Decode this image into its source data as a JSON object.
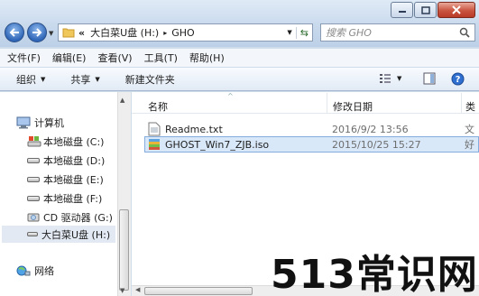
{
  "address": {
    "overflow": "«",
    "crumbs": [
      "大白菜U盘 (H:)",
      "GHO"
    ],
    "separator": "▸"
  },
  "search": {
    "placeholder": "搜索 GHO"
  },
  "menu": [
    "文件(F)",
    "编辑(E)",
    "查看(V)",
    "工具(T)",
    "帮助(H)"
  ],
  "toolbar": {
    "organize": "组织",
    "share": "共享",
    "new_folder": "新建文件夹"
  },
  "sidebar": {
    "computer": "计算机",
    "drives": [
      "本地磁盘 (C:)",
      "本地磁盘 (D:)",
      "本地磁盘 (E:)",
      "本地磁盘 (F:)",
      "CD 驱动器 (G:)",
      "大白菜U盘 (H:)"
    ],
    "network": "网络"
  },
  "columns": {
    "name": "名称",
    "modified": "修改日期",
    "type_partial": "类"
  },
  "files": [
    {
      "name": "Readme.txt",
      "date": "2016/9/2 13:56",
      "type_partial": "文"
    },
    {
      "name": "GHOST_Win7_ZJB.iso",
      "date": "2015/10/25 15:27",
      "type_partial": "好"
    }
  ],
  "watermark": "513常识网",
  "colors": {
    "accent": "#2f66b7",
    "selection": "#d9e8f9",
    "close": "#c9543f"
  },
  "icons": [
    "folder-icon",
    "search-icon",
    "back-arrow-icon",
    "forward-arrow-icon",
    "computer-icon",
    "drive-icon",
    "cd-drive-icon",
    "network-icon",
    "text-file-icon",
    "iso-file-icon",
    "view-options-icon",
    "preview-pane-icon",
    "help-icon"
  ]
}
